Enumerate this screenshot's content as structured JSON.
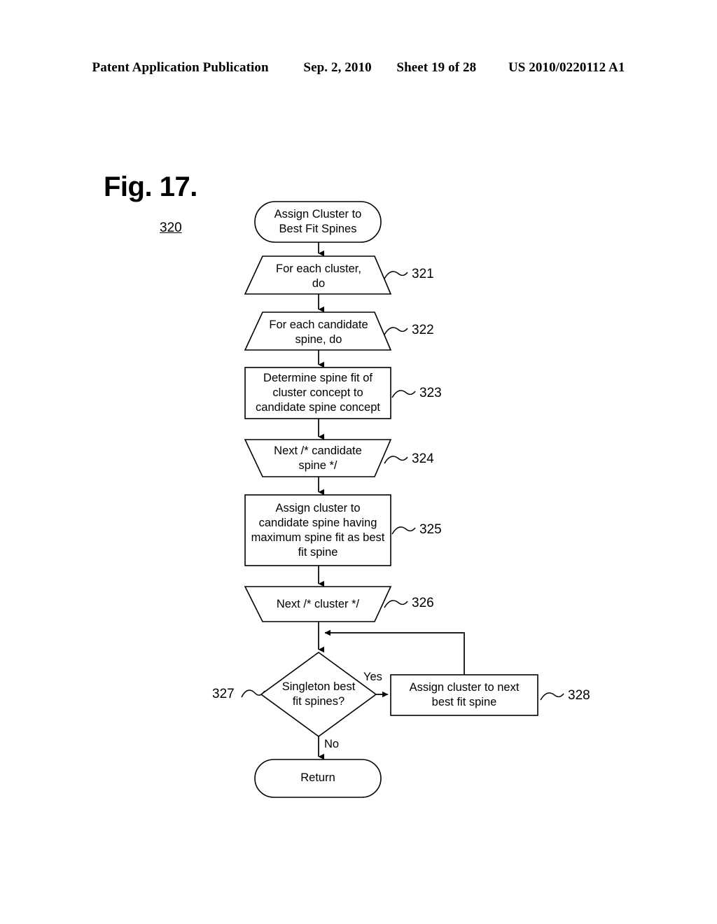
{
  "header": {
    "publication": "Patent Application Publication",
    "date": "Sep. 2, 2010",
    "sheet": "Sheet 19 of 28",
    "patent_number": "US 2010/0220112 A1"
  },
  "figure": {
    "title": "Fig. 17.",
    "reference": "320"
  },
  "flow": {
    "nodes": [
      {
        "id": "start",
        "shape": "terminator",
        "text": "Assign Cluster to\nBest Fit Spines",
        "ref": ""
      },
      {
        "id": "n321",
        "shape": "loop-start",
        "text": "For each cluster,\ndo",
        "ref": "321"
      },
      {
        "id": "n322",
        "shape": "loop-start",
        "text": "For each candidate\nspine, do",
        "ref": "322"
      },
      {
        "id": "n323",
        "shape": "process",
        "text": "Determine spine fit of\ncluster concept to\ncandidate spine concept",
        "ref": "323"
      },
      {
        "id": "n324",
        "shape": "loop-end",
        "text": "Next /* candidate\nspine */",
        "ref": "324"
      },
      {
        "id": "n325",
        "shape": "process",
        "text": "Assign cluster to\ncandidate spine having\nmaximum spine fit as best\nfit spine",
        "ref": "325"
      },
      {
        "id": "n326",
        "shape": "loop-end",
        "text": "Next /* cluster */",
        "ref": "326"
      },
      {
        "id": "n327",
        "shape": "decision",
        "text": "Singleton best\nfit spines?",
        "ref": "327"
      },
      {
        "id": "n328",
        "shape": "process",
        "text": "Assign cluster to next\nbest fit spine",
        "ref": "328"
      },
      {
        "id": "end",
        "shape": "terminator",
        "text": "Return",
        "ref": ""
      }
    ],
    "edge_labels": {
      "yes": "Yes",
      "no": "No"
    }
  },
  "colors": {
    "ink": "#000000",
    "paper": "#ffffff"
  }
}
